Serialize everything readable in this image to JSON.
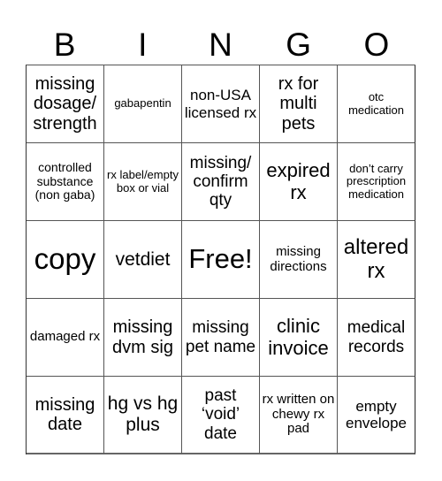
{
  "header": {
    "letters": [
      "B",
      "I",
      "N",
      "G",
      "O"
    ]
  },
  "cells": [
    "missing dosage/ strength",
    "gabapentin",
    "non-USA licensed rx",
    "rx for multi pets",
    "otc medication",
    "controlled substance (non gaba)",
    "rx label/empty box or vial",
    "missing/ confirm qty",
    "expired rx",
    "don’t carry prescription medication",
    "copy",
    "vetdiet",
    "Free!",
    "missing directions",
    "altered rx",
    "damaged rx",
    "missing dvm sig",
    "missing pet name",
    "clinic invoice",
    "medical records",
    "missing date",
    "hg vs hg plus",
    "past ‘void’ date",
    "rx written on chewy rx pad",
    "empty envelope"
  ],
  "free_cell_index": 12
}
